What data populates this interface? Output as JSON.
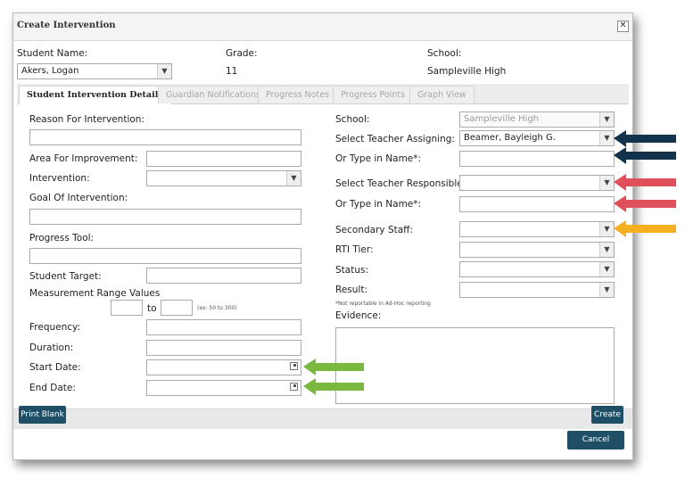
{
  "dialog": {
    "title": "Create Intervention",
    "close_glyph": "✕"
  },
  "header": {
    "student_name_label": "Student Name:",
    "student_name_value": "Akers, Logan",
    "grade_label": "Grade:",
    "grade_value": "11",
    "school_label": "School:",
    "school_value": "Sampleville High"
  },
  "tabs": [
    {
      "label": "Student Intervention Details",
      "active": true
    },
    {
      "label": "Guardian Notifications",
      "active": false
    },
    {
      "label": "Progress Notes",
      "active": false
    },
    {
      "label": "Progress Points",
      "active": false
    },
    {
      "label": "Graph View",
      "active": false
    }
  ],
  "left": {
    "reason_label": "Reason For Intervention:",
    "area_label": "Area For Improvement:",
    "intervention_label": "Intervention:",
    "goal_label": "Goal Of Intervention:",
    "progress_tool_label": "Progress Tool:",
    "student_target_label": "Student Target:",
    "measurement_label": "Measurement Range Values",
    "to_label": "to",
    "range_example": "(ex: 50 to 300)",
    "frequency_label": "Frequency:",
    "duration_label": "Duration:",
    "start_date_label": "Start Date:",
    "end_date_label": "End Date:"
  },
  "right": {
    "school_label": "School:",
    "school_value": "Sampleville High",
    "teacher_assigning_label": "Select Teacher Assigning:",
    "teacher_assigning_value": "Beamer, Bayleigh G.",
    "type_name_label_1": "Or Type in Name*:",
    "teacher_responsible_label": "Select Teacher Responsible:",
    "type_name_label_2": "Or Type in Name*:",
    "secondary_staff_label": "Secondary Staff:",
    "rti_tier_label": "RTI Tier:",
    "status_label": "Status:",
    "result_label": "Result:",
    "note": "*Not reportable in Ad-Hoc reporting",
    "evidence_label": "Evidence:"
  },
  "buttons": {
    "print_blank": "Print Blank",
    "create": "Create",
    "cancel": "Cancel"
  },
  "icons": {
    "dropdown": "chevron-down-icon",
    "calendar": "calendar-icon",
    "close": "close-icon"
  },
  "colors": {
    "button_bg": "#1f4f66",
    "arrow_dark": "#12334b",
    "arrow_red": "#e0505a",
    "arrow_orange": "#f4b020",
    "arrow_green": "#7bb83f"
  }
}
